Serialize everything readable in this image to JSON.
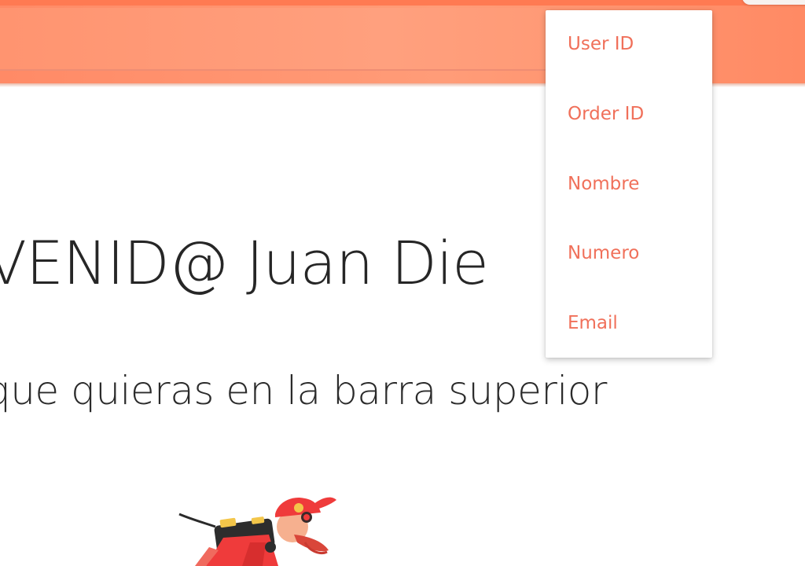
{
  "header": {
    "search": {
      "value": ""
    }
  },
  "dropdown": {
    "items": [
      {
        "label": "User ID"
      },
      {
        "label": "Order ID"
      },
      {
        "label": "Nombre"
      },
      {
        "label": "Numero"
      },
      {
        "label": "Email"
      }
    ]
  },
  "main": {
    "welcome_title": "VENID@ Juan Die",
    "instructions": "que quieras en la barra superior"
  },
  "colors": {
    "topbar": "#ff9470",
    "menu_text": "#f0705a",
    "title_text": "#262626"
  },
  "icons": {
    "illustration": "delivery-courier-illustration"
  }
}
